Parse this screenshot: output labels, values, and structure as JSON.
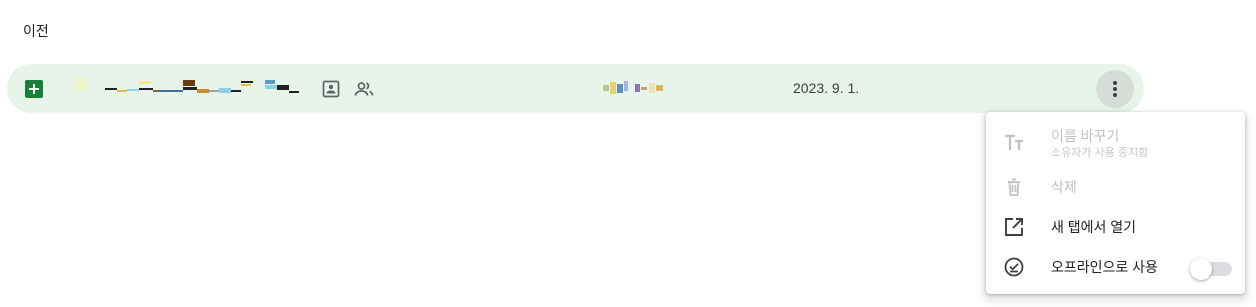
{
  "section": {
    "title": "이전"
  },
  "file": {
    "type_icon": "google-sheets-icon",
    "name": "",
    "name_status": "redacted",
    "shortcut_icon": "contact-card-icon",
    "shared_icon": "people-icon",
    "owner": "",
    "owner_status": "redacted",
    "modified_date": "2023. 9. 1.",
    "row_highlight_color": "#e6f4ea",
    "type_icon_color": "#188038",
    "more_icon": "more-vert-icon"
  },
  "context_menu": {
    "items": [
      {
        "label": "이름 바꾸기",
        "sublabel": "소유자가 사용 중지함",
        "icon": "text-format-icon",
        "enabled": false
      },
      {
        "label": "삭제",
        "icon": "trash-icon",
        "enabled": false
      },
      {
        "label": "새 탭에서 열기",
        "icon": "open-in-new-icon",
        "enabled": true
      },
      {
        "label": "오프라인으로 사용",
        "icon": "offline-pin-icon",
        "enabled": true,
        "toggle_on": false
      }
    ]
  }
}
